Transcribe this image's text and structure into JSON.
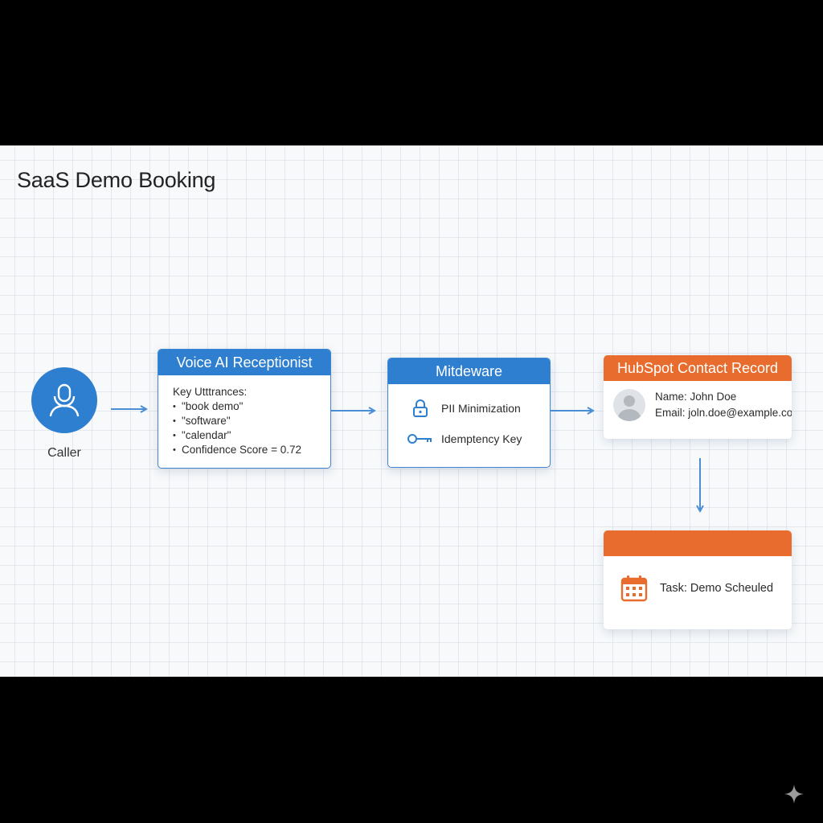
{
  "title": "SaaS Demo Booking",
  "colors": {
    "blue_accent": "#2f7fd0",
    "orange_accent": "#e86c2e",
    "arrow": "#4a8fd6",
    "grid": "#e3e8ee"
  },
  "caller": {
    "label": "Caller",
    "icon": "person-headset-icon"
  },
  "voice_node": {
    "title": "Voice AI Receptionist",
    "heading": "Key Utttrances:",
    "items": [
      "\"book demo\"",
      "\"software\"",
      "\"calendar\"",
      "Confidence Score = 0.72"
    ]
  },
  "middleware_node": {
    "title": "Mitdeware",
    "rows": [
      {
        "label": "PII Minimization",
        "icon": "lock-icon"
      },
      {
        "label": "Idemptency Key",
        "icon": "key-icon"
      }
    ]
  },
  "hubspot_node": {
    "title": "HubSpot Contact Record",
    "name": "Name: John Doe",
    "email": "Email: joln.doe@example.com",
    "icon": "avatar-icon"
  },
  "task_node": {
    "title": "",
    "label": "Task: Demo Scheuled",
    "icon": "calendar-icon"
  }
}
